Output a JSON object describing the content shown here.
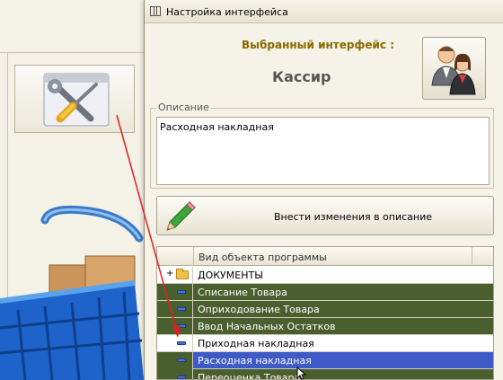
{
  "dialog": {
    "title": "Настройка интерфейса",
    "selected_label": "Выбранный интерфейс :",
    "selected_value": "Кассир",
    "description_legend": "Описание",
    "description_text": "Расходная накладная",
    "edit_button_label": "Внести изменения в описание"
  },
  "grid": {
    "column_header": "Вид объекта программы",
    "rows": [
      {
        "label": "ДОКУМЕНТЫ",
        "style": "folder"
      },
      {
        "label": "Списание Товара",
        "style": "green"
      },
      {
        "label": "Оприходование Товара",
        "style": "green"
      },
      {
        "label": "Ввод Начальных Остатков",
        "style": "green"
      },
      {
        "label": "Приходная накладная",
        "style": "white"
      },
      {
        "label": "Расходная накладная",
        "style": "selected"
      },
      {
        "label": "Переоценка  Товара",
        "style": "green"
      }
    ]
  },
  "colors": {
    "row_green": "#4a5f2e",
    "row_selected": "#3d5ac8",
    "selected_label": "#8a6a00",
    "annotation_arrow": "#e02020"
  },
  "icons": {
    "tools": "wrench-screwdriver-icon",
    "users": "users-icon",
    "pencil": "pencil-icon",
    "folder": "folder-icon",
    "row_marker": "dash-icon"
  }
}
